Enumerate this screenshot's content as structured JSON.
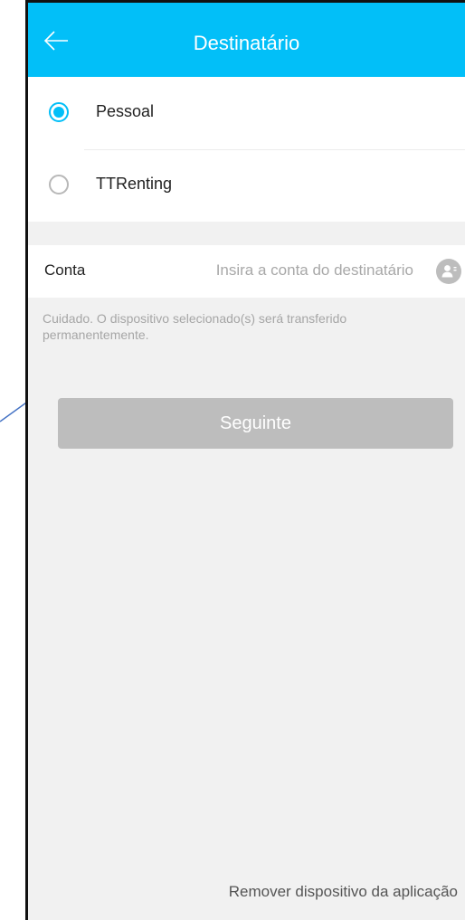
{
  "header": {
    "title": "Destinatário",
    "back_icon": "arrow-left-icon"
  },
  "recipient_type": {
    "selected": "Pessoal",
    "options": [
      {
        "label": "Pessoal",
        "checked": true
      },
      {
        "label": "TTRenting",
        "checked": false
      }
    ]
  },
  "account": {
    "label": "Conta",
    "value": "",
    "placeholder": "Insira a conta do destinatário",
    "contact_icon": "contact-book-icon"
  },
  "warning": {
    "text": "Cuidado. O dispositivo selecionado(s) será transferido permanentemente."
  },
  "next_button": {
    "label": "Seguinte",
    "enabled": false
  },
  "footer": {
    "remove_label": "Remover dispositivo da aplicação"
  },
  "colors": {
    "accent": "#02bff8",
    "background": "#f1f1f1",
    "button_disabled": "#bdbdbd",
    "annotation_line": "#4472c4"
  }
}
